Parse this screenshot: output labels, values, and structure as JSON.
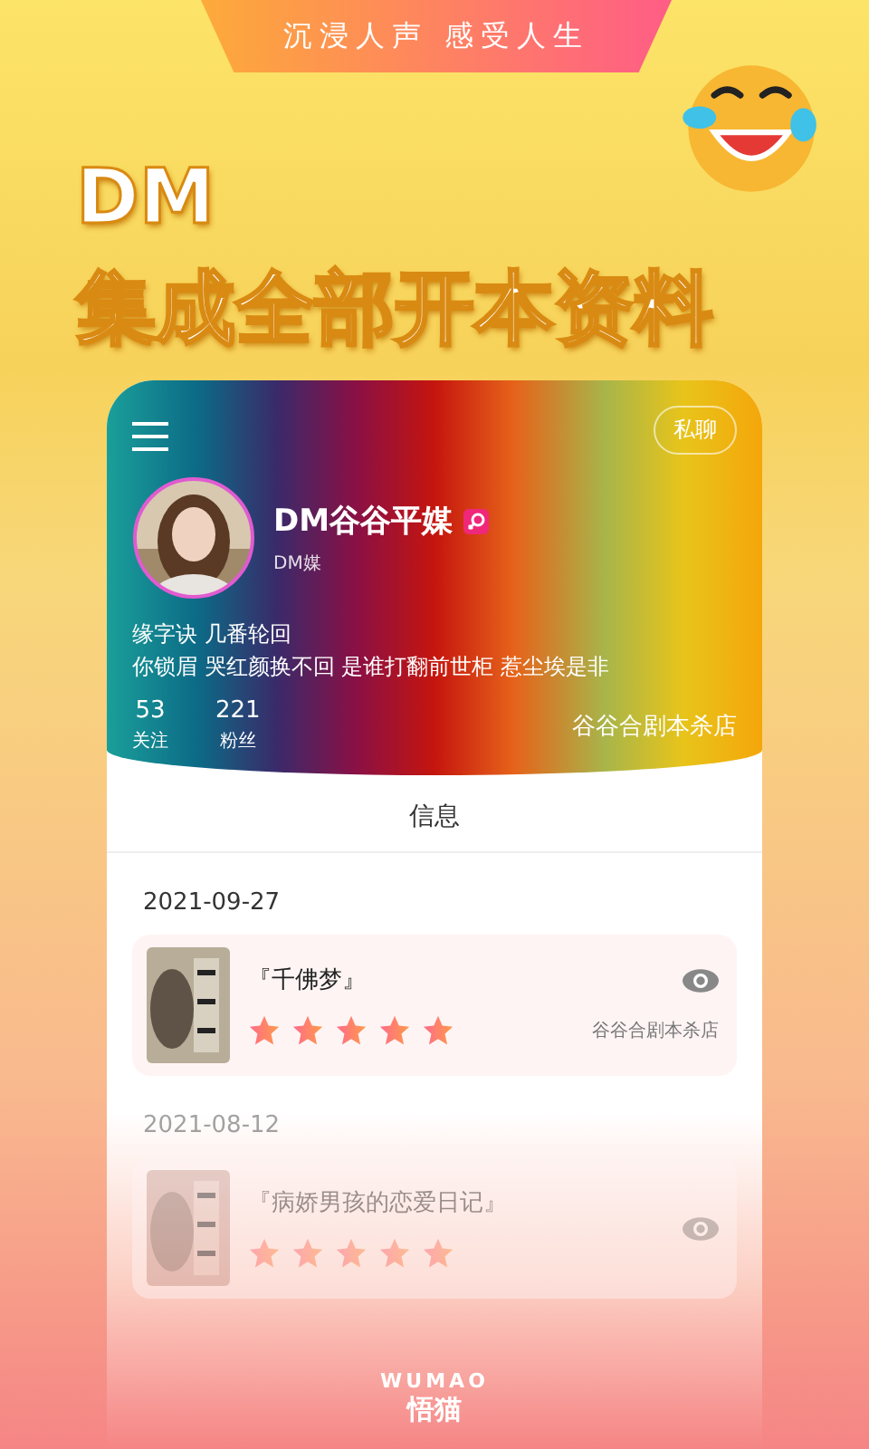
{
  "banner": {
    "slogan": "沉浸人声 感受人生"
  },
  "headline": [
    "DM",
    "集成全部开本资料"
  ],
  "profile": {
    "chat_button": "私聊",
    "name": "DM谷谷平媒",
    "role": "DM媒",
    "bio": [
      "缘字诀 几番轮回",
      "你锁眉 哭红颜换不回 是谁打翻前世柜 惹尘埃是非"
    ],
    "stats": [
      {
        "value": "53",
        "label": "关注"
      },
      {
        "value": "221",
        "label": "粉丝"
      }
    ],
    "store": "谷谷合剧本杀店"
  },
  "section_title": "信息",
  "entries": [
    {
      "date": "2021-09-27",
      "title": "『千佛梦』",
      "stars": 5,
      "store": "谷谷合剧本杀店",
      "faded": false
    },
    {
      "date": "2021-08-12",
      "title": "『病娇男孩的恋爱日记』",
      "stars": 5,
      "faded": true
    }
  ],
  "logo": {
    "latin": "WUMAO",
    "name": "悟猫"
  }
}
